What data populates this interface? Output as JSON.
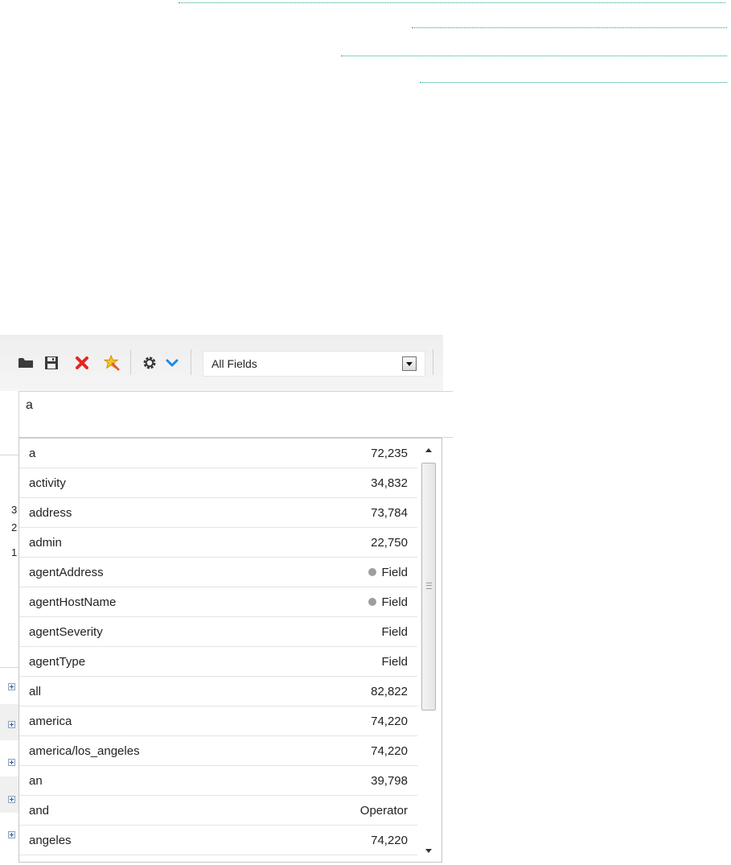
{
  "toolbar": {
    "field_select": {
      "selected": "All Fields"
    },
    "icons": [
      "folder-icon",
      "save-icon",
      "delete-icon",
      "magic-wand-icon",
      "gear-icon",
      "chevron-down-icon"
    ]
  },
  "search": {
    "value": "a"
  },
  "background": {
    "chars": [
      "3",
      "2",
      "1"
    ]
  },
  "suggestions": [
    {
      "term": "a",
      "value": "72,235",
      "dot": false
    },
    {
      "term": "activity",
      "value": "34,832",
      "dot": false
    },
    {
      "term": "address",
      "value": "73,784",
      "dot": false
    },
    {
      "term": "admin",
      "value": "22,750",
      "dot": false
    },
    {
      "term": "agentAddress",
      "value": "Field",
      "dot": true
    },
    {
      "term": "agentHostName",
      "value": "Field",
      "dot": true
    },
    {
      "term": "agentSeverity",
      "value": "Field",
      "dot": false
    },
    {
      "term": "agentType",
      "value": "Field",
      "dot": false
    },
    {
      "term": "all",
      "value": "82,822",
      "dot": false
    },
    {
      "term": "america",
      "value": "74,220",
      "dot": false
    },
    {
      "term": "america/los_angeles",
      "value": "74,220",
      "dot": false
    },
    {
      "term": "an",
      "value": "39,798",
      "dot": false
    },
    {
      "term": "and",
      "value": "Operator",
      "dot": false
    },
    {
      "term": "angeles",
      "value": "74,220",
      "dot": false
    }
  ],
  "colors": {
    "guide_line": "#19a38a",
    "delete_icon": "#e32626",
    "chevron": "#1e88e5",
    "status_dot": "#9e9e9e"
  }
}
